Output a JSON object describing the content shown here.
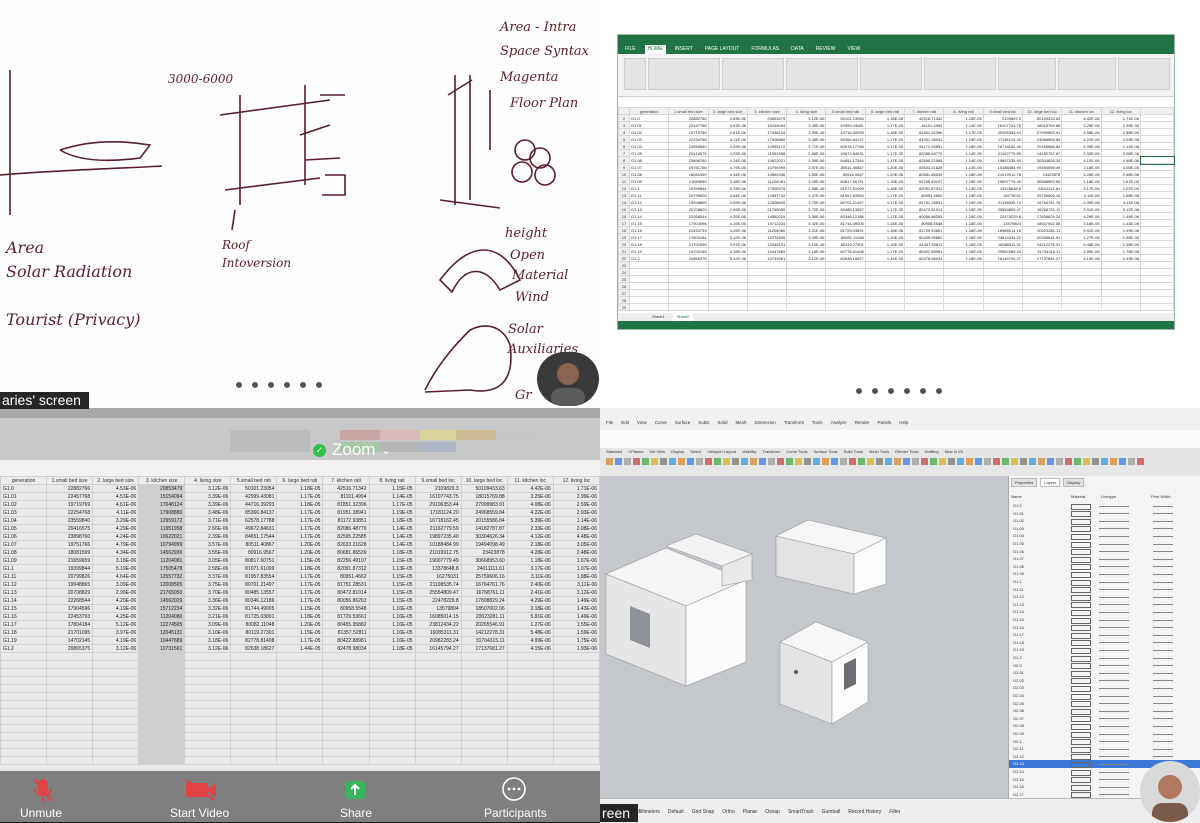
{
  "sketch": {
    "notes": [
      "3000-6000",
      "Area",
      "Solar Radiation",
      "Tourist (Privacy)",
      "Roof",
      "Intoversion",
      "Area - Intra",
      "Space Syntax",
      "Magenta",
      "Floor Plan",
      "height",
      "Open",
      "Material",
      "Wind",
      "Solar",
      "Auxiliaries",
      "Gr"
    ]
  },
  "excel_top": {
    "ribbon_tabs": [
      "FILE",
      "HOME",
      "INSERT",
      "PAGE LAYOUT",
      "FORMULAS",
      "DATA",
      "REVIEW",
      "VIEW"
    ],
    "columns": [
      "generation",
      "1.small bed size",
      "2. large bed size",
      "3. kitchen size",
      "4. living size",
      "5.small bed rati",
      "6. large bed rati",
      "7. kitchen rati",
      "8. living rati",
      "9.small bed loc",
      "10. large bed loc",
      "11. kitchen loc",
      "12. living loc"
    ],
    "rows": [
      [
        "G1.0",
        "22882766",
        "4.53E-06",
        "20853479",
        "3.12E-06",
        "50101.23054",
        "1.18E-05",
        "42516.71342",
        "1.15E-05",
        "2109829.3",
        "50109433.63",
        "4.42E-06",
        "1.71E-06"
      ],
      [
        "G1.01",
        "22457768",
        "4.53E-06",
        "15154094",
        "3.39E-06",
        "42999.43081",
        "1.17E-05",
        "81101.4994",
        "1.14E-05",
        "16107743.75",
        "18015769.88",
        "3.25E-06",
        "2.99E-06"
      ],
      [
        "G1.02",
        "19719769",
        "4.61E-06",
        "17048124",
        "3.39E-06",
        "44716.39293",
        "1.18E-05",
        "81851.32396",
        "1.17E-05",
        "29106353.44",
        "27999983.91",
        "4.08E-06",
        "2.59E-06"
      ],
      [
        "G1.03",
        "22254768",
        "4.11E-06",
        "17908880",
        "3.48E-06",
        "85366.84137",
        "1.17E-05",
        "81951.38941",
        "1.19E-05",
        "17181124.20",
        "24968559.84",
        "4.22E-06",
        "2.93E-06"
      ],
      [
        "G1.04",
        "23559840",
        "3.29E-06",
        "12959172",
        "3.71E-06",
        "62578.17788",
        "1.17E-05",
        "81172.93851",
        "1.18E-05",
        "16718162.45",
        "20155586.84",
        "5.39E-06",
        "1.14E-06"
      ],
      [
        "G1.05",
        "20416575",
        "4.29E-06",
        "11951958",
        "2.66E-06",
        "49672.84631",
        "1.17E-05",
        "82086.48779",
        "1.14E-05",
        "21162779.59",
        "14182787.87",
        "2.33E-06",
        "2.08E-06"
      ],
      [
        "G1.06",
        "23898760",
        "4.24E-06",
        "10622021",
        "2.39E-06",
        "84651.17544",
        "1.17E-05",
        "82595.22585",
        "1.14E-05",
        "19897235.40",
        "30304626.34",
        "4.12E-06",
        "4.48E-06"
      ],
      [
        "G1.07",
        "19751766",
        "4.79E-06",
        "10794999",
        "3.57E-06",
        "80511.40867",
        "1.20E-05",
        "82633.21628",
        "1.14E-05",
        "10188484.99",
        "19494098.49",
        "2.18E-06",
        "3.05E-06"
      ],
      [
        "G1.08",
        "18081599",
        "4.34E-06",
        "14562936",
        "3.55E-06",
        "80916.9567",
        "1.20E-05",
        "80681.86539",
        "1.18E-05",
        "21019912.75",
        "23423878",
        "4.28E-06",
        "2.48E-06"
      ],
      [
        "G1.09",
        "21659659",
        "3.18E-06",
        "11204081",
        "3.05E-06",
        "80817.60751",
        "1.15E-05",
        "82256.49107",
        "1.15E-05",
        "19007779.49",
        "30668953.60",
        "1.18E-06",
        "1.67E-06"
      ],
      [
        "G1.1",
        "19399844",
        "5.19E-06",
        "17505478",
        "2.58E-06",
        "81071.61099",
        "1.18E-05",
        "82091.87312",
        "1.13E-05",
        "13378648.8",
        "24011111.61",
        "3.17E-06",
        "1.07E-06"
      ],
      [
        "G1.11",
        "20799826",
        "4.64E-06",
        "12557732",
        "3.37E-06",
        "81957.83554",
        "1.17E-05",
        "80951.4662",
        "1.15E-05",
        "16275031",
        "25759606.16",
        "3.11E-06",
        "1.88E-06"
      ],
      [
        "G1.12",
        "19948865",
        "3.09E-06",
        "12008505",
        "3.75E-06",
        "80701.21497",
        "1.17E-05",
        "81751.28531",
        "1.15E-05",
        "21198535.74",
        "16764761.76",
        "2.40E-06",
        "3.11E-06"
      ],
      [
        "G1.13",
        "20708829",
        "2.99E-06",
        "21765050",
        "3.70E-06",
        "80485.13557",
        "1.17E-05",
        "80472.81014",
        "1.15E-05",
        "25554809.47",
        "16768761.11",
        "2.41E-06",
        "3.12E-06"
      ],
      [
        "G1.14",
        "22268544",
        "4.20E-06",
        "14562029",
        "3.36E-06",
        "80346.12186",
        "1.17E-05",
        "80056.86263",
        "1.15E-05",
        "22478229.8",
        "17808829.24",
        "4.29E-06",
        "1.49E-06"
      ],
      [
        "G1.15",
        "17904596",
        "4.19E-06",
        "15712234",
        "3.32E-06",
        "81744.49005",
        "1.15E-05",
        "80958.5548",
        "1.16E-05",
        "13579804",
        "18507002.06",
        "3.18E-06",
        "1.43E-06"
      ],
      [
        "G1.16",
        "22453793",
        "4.25E-06",
        "11204080",
        "3.21E-06",
        "81725.03891",
        "1.18E-05",
        "81729.53661",
        "1.16E-05",
        "16085014.15",
        "20023281.11",
        "5.91E-06",
        "1.49E-06"
      ],
      [
        "G1.17",
        "17804184",
        "5.12E-06",
        "12274505",
        "3.09E-06",
        "80082.11048",
        "1.20E-05",
        "80455.95882",
        "1.16E-05",
        "23812434.22",
        "20265546.91",
        "1.27E-06",
        "1.55E-06"
      ],
      [
        "G1.18",
        "21701095",
        "3.97E-06",
        "12045131",
        "3.10E-06",
        "80119.27301",
        "1.15E-05",
        "81357.52811",
        "1.16E-05",
        "16085311.31",
        "14212278.31",
        "5.48E-06",
        "1.59E-06"
      ],
      [
        "G1.19",
        "14702145",
        "4.19E-06",
        "10447689",
        "3.18E-06",
        "82778.81408",
        "1.17E-05",
        "80422.88981",
        "1.16E-05",
        "20982283.24",
        "31704315.11",
        "4.99E-06",
        "1.75E-06"
      ],
      [
        "G1.2",
        "20865375",
        "3.12E-06",
        "10731561",
        "3.12E-06",
        "82638.18627",
        "1.44E-05",
        "82478.98034",
        "1.18E-05",
        "16145794.27",
        "17137681.27",
        "4.15E-06",
        "1.93E-06"
      ]
    ],
    "sheet_tabs": [
      "Sheet1",
      "Sheet2"
    ]
  },
  "zoom": {
    "caption_left": "aries' screen",
    "caption_right": "reen",
    "label": "Zoom",
    "buttons": [
      "Unmute",
      "Start Video",
      "Share",
      "Participants"
    ]
  },
  "rhino": {
    "menus": [
      "File",
      "Edit",
      "View",
      "Curve",
      "Surface",
      "SubD",
      "Solid",
      "Mesh",
      "Dimension",
      "Transform",
      "Tools",
      "Analyze",
      "Render",
      "Panels",
      "Help"
    ],
    "tabs": [
      "Standard",
      "CPlanes",
      "Set View",
      "Display",
      "Select",
      "Viewport Layout",
      "Visibility",
      "Transform",
      "Curve Tools",
      "Surface Tools",
      "Solid Tools",
      "Mesh Tools",
      "Render Tools",
      "Drafting",
      "New in V6"
    ],
    "panel_tabs": [
      "Properties",
      "Layers",
      "Display"
    ],
    "layer_headers": [
      "Name",
      "Material",
      "Linetype",
      "Print Width"
    ],
    "layers": [
      "G1.0",
      "G1.01",
      "G1.02",
      "G1.03",
      "G1.04",
      "G1.05",
      "G1.06",
      "G1.07",
      "G1.08",
      "G1.09",
      "G1.1",
      "G1.11",
      "G1.12",
      "G1.13",
      "G1.14",
      "G1.15",
      "G1.16",
      "G1.17",
      "G1.18",
      "G1.19",
      "G1.2",
      "G2.0",
      "G2.01",
      "G2.02",
      "G2.03",
      "G2.04",
      "G2.05",
      "G2.06",
      "G2.07",
      "G2.08",
      "G2.09",
      "G2.1",
      "G2.11",
      "G2.12",
      "G2.13",
      "G2.14",
      "G2.15",
      "G2.16",
      "G2.17"
    ],
    "status": [
      "Millimeters",
      "Default",
      "Grid Snap",
      "Ortho",
      "Planar",
      "Osnap",
      "SmartTrack",
      "Gumball",
      "Record History",
      "Filter"
    ]
  }
}
